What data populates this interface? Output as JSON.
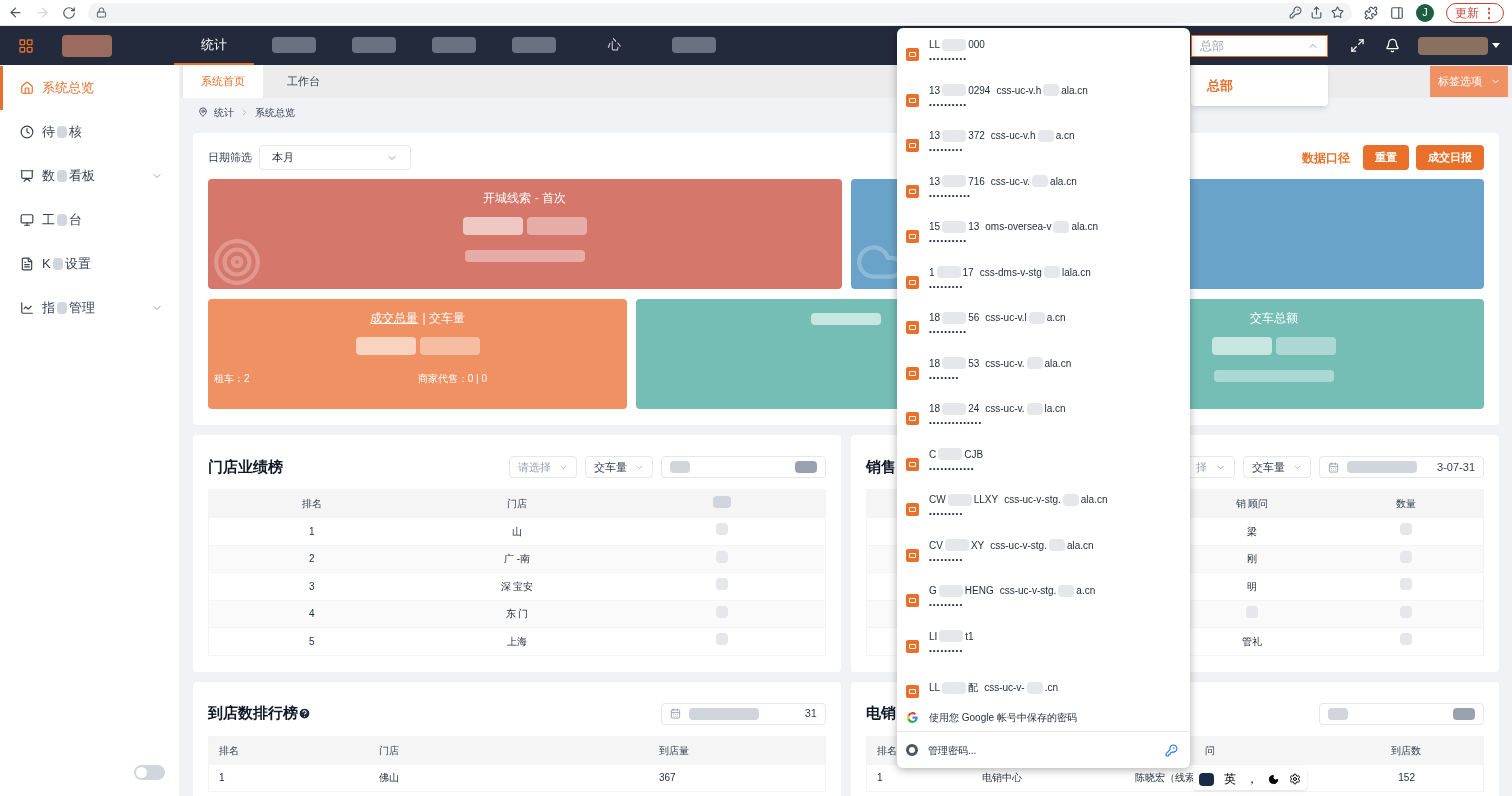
{
  "browser": {
    "update_button": "更新",
    "menu_glyph": "⋮",
    "profile_initial": "J"
  },
  "header": {
    "nav": [
      {
        "kind": "text",
        "label": "统计",
        "selected": true
      },
      {
        "kind": "redacted",
        "selected": false
      },
      {
        "kind": "redacted",
        "selected": false
      },
      {
        "kind": "redacted",
        "selected": false
      },
      {
        "kind": "redacted",
        "selected": false
      },
      {
        "kind": "text",
        "label": "心",
        "selected": false
      },
      {
        "kind": "redacted",
        "selected": false
      }
    ],
    "org_select": {
      "placeholder": "总部",
      "expanded": true,
      "options": [
        {
          "label": "总部",
          "selected": true
        }
      ]
    }
  },
  "sidebar": {
    "items": [
      {
        "parts": [
          "系统总览"
        ],
        "selected": true
      },
      {
        "parts": [
          "待",
          "核"
        ],
        "selected": false
      },
      {
        "parts": [
          "数",
          "看板"
        ],
        "selected": false,
        "expanded": false
      },
      {
        "parts": [
          "工",
          "台"
        ],
        "selected": false
      },
      {
        "parts": [
          "K",
          "设置"
        ],
        "selected": false
      },
      {
        "parts": [
          "指",
          "管理"
        ],
        "selected": false,
        "expanded": false
      }
    ],
    "toggle": {
      "on": false
    }
  },
  "tabs": [
    {
      "label": "系统首页",
      "selected": true
    },
    {
      "label": "工作台",
      "selected": false
    }
  ],
  "tab_options_button": "标签选项",
  "breadcrumb": [
    "统计",
    "系统总览"
  ],
  "filter": {
    "label": "日期筛选",
    "value": "本月"
  },
  "actions": {
    "link": "数据口径",
    "buttons": [
      "重置",
      "成交日报"
    ]
  },
  "stat_rows": [
    [
      {
        "title_parts": [
          "开城线索 - 首次"
        ],
        "color": "#d6776b"
      },
      {
        "color": "#6aa3c9"
      }
    ],
    [
      {
        "title_parts": [
          "成交总量",
          "| 交车量"
        ],
        "color": "#ef9163",
        "notes": [
          "租车：2",
          "商家代售：0 | 0"
        ]
      },
      {
        "color": "#74beb5"
      },
      {
        "title_parts": [
          "交车总额"
        ],
        "color": "#74beb5"
      }
    ]
  ],
  "panels": [
    {
      "title": "门店业绩榜",
      "controls": [
        {
          "kind": "select",
          "placeholder": "请选择"
        },
        {
          "kind": "select",
          "value": "交车量"
        },
        {
          "kind": "masked"
        }
      ],
      "columns": [
        {
          "label": "排名"
        },
        {
          "label": "门店"
        },
        {
          "kind": "masked"
        }
      ],
      "rows": [
        [
          "1",
          "山",
          null
        ],
        [
          "2",
          "广  -南",
          null
        ],
        [
          "3",
          "深  宝安",
          null
        ],
        [
          "4",
          "东  门",
          null
        ],
        [
          "5",
          "上海",
          null
        ]
      ]
    },
    {
      "title": "销售",
      "controls": [
        {
          "kind": "select",
          "placeholder": "择"
        },
        {
          "kind": "select",
          "value": "交车量"
        },
        {
          "kind": "date",
          "value": "3-07-31"
        }
      ],
      "columns": [
        {
          "kind": "covered"
        },
        {
          "kind": "covered"
        },
        {
          "label": "销  顾问"
        },
        {
          "label": "数量"
        }
      ],
      "rows": [
        [
          null,
          null,
          "梁",
          null
        ],
        [
          null,
          null,
          "刚",
          null
        ],
        [
          null,
          null,
          "明",
          null
        ],
        [
          null,
          null,
          null,
          null
        ],
        [
          null,
          null,
          "管礼",
          null
        ]
      ]
    },
    {
      "title": "到店数排行榜",
      "help": true,
      "controls": [
        {
          "kind": "date",
          "value": "31"
        }
      ],
      "columns": [
        {
          "label": "排名"
        },
        {
          "label": "门店"
        },
        {
          "label": "到店量"
        }
      ],
      "rows": [
        [
          "1",
          "佛山",
          "367"
        ]
      ]
    },
    {
      "title": "电销",
      "controls": [
        {
          "kind": "masked"
        }
      ],
      "columns": [
        {
          "label": "排名"
        },
        {
          "kind": "covered"
        },
        {
          "label": "问"
        },
        {
          "label": "到店数"
        }
      ],
      "rows": [
        [
          "1",
          "电销中心",
          "陈晓宏（线索",
          "152"
        ]
      ]
    }
  ],
  "password_menu": {
    "entries": [
      {
        "user": [
          "LL",
          "000"
        ],
        "password": "••••••••••"
      },
      {
        "user": [
          "13",
          "0294"
        ],
        "site": [
          "css-uc-v.h",
          "ala.cn"
        ],
        "password": "••••••••••"
      },
      {
        "user": [
          "13",
          "372"
        ],
        "site": [
          "css-uc-v.h",
          "a.cn"
        ],
        "password": "•••••••••"
      },
      {
        "user": [
          "13",
          "716"
        ],
        "site": [
          "css-uc-v.",
          "ala.cn"
        ],
        "password": "•••••••••••"
      },
      {
        "user": [
          "15",
          "13"
        ],
        "site": [
          "oms-oversea-v",
          "ala.cn"
        ],
        "password": "••••••••••"
      },
      {
        "user": [
          "1",
          "17"
        ],
        "site": [
          "css-dms-v-stg",
          "lala.cn"
        ],
        "password": "•••••••••"
      },
      {
        "user": [
          "18",
          "56"
        ],
        "site": [
          "css-uc-v.l",
          "a.cn"
        ],
        "password": "••••••••••"
      },
      {
        "user": [
          "18",
          "53"
        ],
        "site": [
          "css-uc-v.",
          "ala.cn"
        ],
        "password": "••••••••"
      },
      {
        "user": [
          "18",
          "24"
        ],
        "site": [
          "css-uc-v.",
          "la.cn"
        ],
        "password": "••••••••••••••"
      },
      {
        "user": [
          "C",
          "CJB"
        ],
        "password": "••••••••••••"
      },
      {
        "user": [
          "CW",
          "LLXY"
        ],
        "site": [
          "css-uc-v-stg.",
          "ala.cn"
        ],
        "password": "•••••••••"
      },
      {
        "user": [
          "CV",
          "XY"
        ],
        "site": [
          "css-uc-v-stg.",
          "ala.cn"
        ],
        "password": "•••••••••"
      },
      {
        "user": [
          "G",
          "HENG"
        ],
        "site": [
          "css-uc-v-stg.",
          "a.cn"
        ],
        "password": "•••••••••"
      },
      {
        "user": [
          "LI",
          "t1"
        ],
        "password": "•••••••••"
      },
      {
        "user": [
          "LL",
          "配"
        ],
        "site": [
          "css-uc-v-",
          ".cn"
        ]
      }
    ],
    "google_note": "使用您 Google 帐号中保存的密码",
    "manage": "管理密码..."
  },
  "ime_bar": {
    "mode": "英",
    "punct": "，"
  }
}
